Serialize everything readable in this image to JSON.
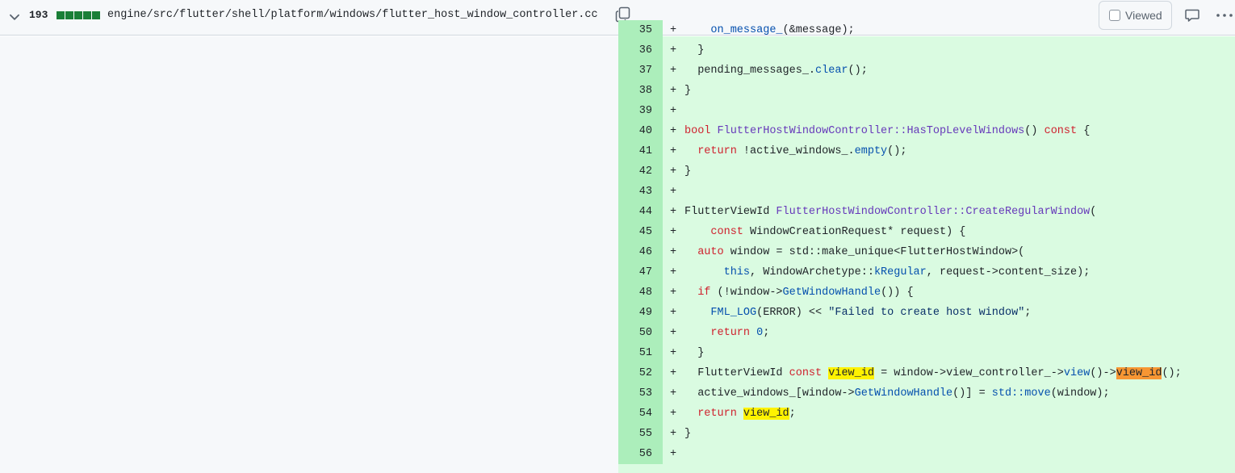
{
  "header": {
    "changes_count": "193",
    "diffstat_colors": [
      "#1a7f37",
      "#1a7f37",
      "#1a7f37",
      "#1a7f37",
      "#1a7f37"
    ],
    "file_path": "engine/src/flutter/shell/platform/windows/flutter_host_window_controller.cc",
    "viewed_label": "Viewed",
    "icons": [
      "chevron-down-icon",
      "copy-icon",
      "comment-icon",
      "kebab-horizontal-icon"
    ]
  },
  "diff": {
    "added_marker": "+",
    "lines": [
      {
        "num": "35",
        "segs": [
          {
            "t": "    "
          },
          {
            "t": "on_message_",
            "c": "c"
          },
          {
            "t": "(&message);"
          }
        ]
      },
      {
        "num": "36",
        "segs": [
          {
            "t": "  }"
          }
        ]
      },
      {
        "num": "37",
        "segs": [
          {
            "t": "  pending_messages_."
          },
          {
            "t": "clear",
            "c": "c"
          },
          {
            "t": "();"
          }
        ]
      },
      {
        "num": "38",
        "segs": [
          {
            "t": "}"
          }
        ]
      },
      {
        "num": "39",
        "segs": []
      },
      {
        "num": "40",
        "segs": [
          {
            "t": "bool",
            "c": "k"
          },
          {
            "t": " "
          },
          {
            "t": "FlutterHostWindowController::HasTopLevelWindows",
            "c": "f"
          },
          {
            "t": "() "
          },
          {
            "t": "const",
            "c": "k"
          },
          {
            "t": " {"
          }
        ]
      },
      {
        "num": "41",
        "segs": [
          {
            "t": "  "
          },
          {
            "t": "return",
            "c": "k"
          },
          {
            "t": " !active_windows_."
          },
          {
            "t": "empty",
            "c": "c"
          },
          {
            "t": "();"
          }
        ]
      },
      {
        "num": "42",
        "segs": [
          {
            "t": "}"
          }
        ]
      },
      {
        "num": "43",
        "segs": []
      },
      {
        "num": "44",
        "segs": [
          {
            "t": "FlutterViewId "
          },
          {
            "t": "FlutterHostWindowController::CreateRegularWindow",
            "c": "f"
          },
          {
            "t": "("
          }
        ]
      },
      {
        "num": "45",
        "segs": [
          {
            "t": "    "
          },
          {
            "t": "const",
            "c": "k"
          },
          {
            "t": " WindowCreationRequest* request) {"
          }
        ]
      },
      {
        "num": "46",
        "segs": [
          {
            "t": "  "
          },
          {
            "t": "auto",
            "c": "k"
          },
          {
            "t": " window = std::make_unique<FlutterHostWindow>("
          }
        ]
      },
      {
        "num": "47",
        "segs": [
          {
            "t": "      "
          },
          {
            "t": "this",
            "c": "c"
          },
          {
            "t": ", WindowArchetype::"
          },
          {
            "t": "kRegular",
            "c": "c"
          },
          {
            "t": ", request->content_size);"
          }
        ]
      },
      {
        "num": "48",
        "segs": [
          {
            "t": "  "
          },
          {
            "t": "if",
            "c": "k"
          },
          {
            "t": " (!window->"
          },
          {
            "t": "GetWindowHandle",
            "c": "c"
          },
          {
            "t": "()) {"
          }
        ]
      },
      {
        "num": "49",
        "segs": [
          {
            "t": "    "
          },
          {
            "t": "FML_LOG",
            "c": "c"
          },
          {
            "t": "(ERROR) << "
          },
          {
            "t": "\"Failed to create host window\"",
            "c": "s"
          },
          {
            "t": ";"
          }
        ]
      },
      {
        "num": "50",
        "segs": [
          {
            "t": "    "
          },
          {
            "t": "return",
            "c": "k"
          },
          {
            "t": " "
          },
          {
            "t": "0",
            "c": "c"
          },
          {
            "t": ";"
          }
        ]
      },
      {
        "num": "51",
        "segs": [
          {
            "t": "  }"
          }
        ]
      },
      {
        "num": "52",
        "segs": [
          {
            "t": "  FlutterViewId "
          },
          {
            "t": "const",
            "c": "k"
          },
          {
            "t": " "
          },
          {
            "t": "view_id",
            "c": "hl"
          },
          {
            "t": " = window->view_controller_->"
          },
          {
            "t": "view",
            "c": "c"
          },
          {
            "t": "()->"
          },
          {
            "t": "view_id",
            "c": "hl2"
          },
          {
            "t": "();"
          }
        ]
      },
      {
        "num": "53",
        "segs": [
          {
            "t": "  active_windows_[window->"
          },
          {
            "t": "GetWindowHandle",
            "c": "c"
          },
          {
            "t": "()] = "
          },
          {
            "t": "std::move",
            "c": "c"
          },
          {
            "t": "(window);"
          }
        ]
      },
      {
        "num": "54",
        "segs": [
          {
            "t": "  "
          },
          {
            "t": "return",
            "c": "k"
          },
          {
            "t": " "
          },
          {
            "t": "view_id",
            "c": "hl"
          },
          {
            "t": ";"
          }
        ]
      },
      {
        "num": "55",
        "segs": [
          {
            "t": "}"
          }
        ]
      },
      {
        "num": "56",
        "segs": []
      }
    ]
  }
}
